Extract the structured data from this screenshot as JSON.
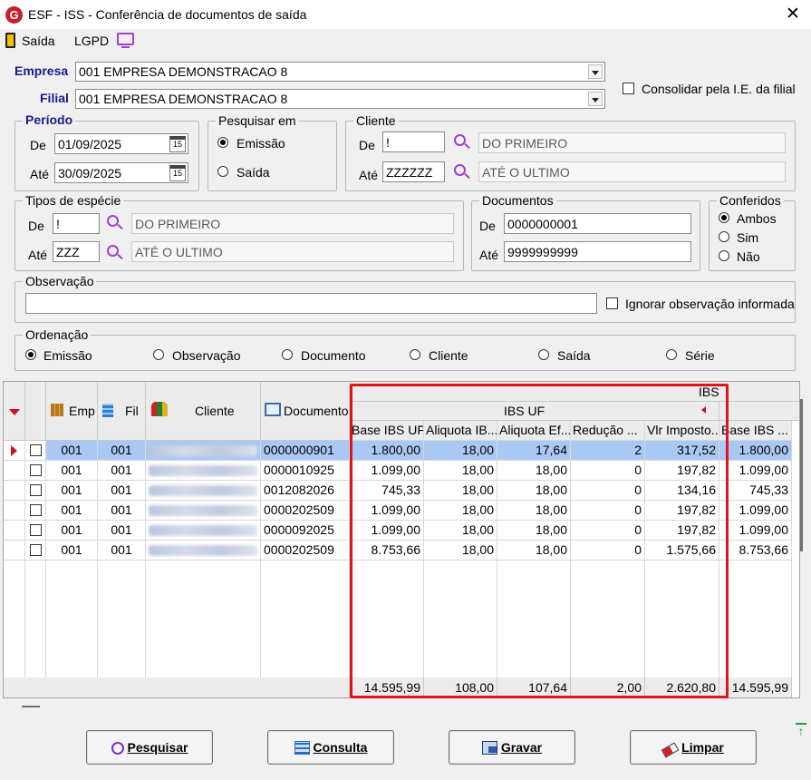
{
  "window": {
    "title": "ESF - ISS - Conferência de documentos de saída",
    "close": "✕"
  },
  "menu": {
    "saida": "Saída",
    "lgpd": "LGPD"
  },
  "empresa": {
    "label": "Empresa",
    "value": "001 EMPRESA DEMONSTRACAO 8"
  },
  "filial": {
    "label": "Filial",
    "value": "001 EMPRESA DEMONSTRACAO 8"
  },
  "consolidar": {
    "label": "Consolidar pela I.E. da filial",
    "checked": false
  },
  "periodo": {
    "title": "Período",
    "de_label": "De",
    "de": "01/09/2025",
    "ate_label": "Até",
    "ate": "30/09/2025",
    "cal_icon": "15"
  },
  "pesquisar_em": {
    "title": "Pesquisar em",
    "options": [
      "Emissão",
      "Saída"
    ],
    "selected": "Emissão"
  },
  "cliente": {
    "title": "Cliente",
    "de_label": "De",
    "de": "!",
    "de_desc": "DO PRIMEIRO",
    "ate_label": "Até",
    "ate": "ZZZZZZ",
    "ate_desc": "ATÉ O ULTIMO"
  },
  "especie": {
    "title": "Tipos de espécie",
    "de_label": "De",
    "de": "!",
    "de_desc": "DO PRIMEIRO",
    "ate_label": "Até",
    "ate": "ZZZ",
    "ate_desc": "ATÉ O ULTIMO"
  },
  "documentos": {
    "title": "Documentos",
    "de_label": "De",
    "de": "0000000001",
    "ate_label": "Até",
    "ate": "9999999999"
  },
  "conferidos": {
    "title": "Conferidos",
    "options": [
      "Ambos",
      "Sim",
      "Não"
    ],
    "selected": "Ambos"
  },
  "observacao": {
    "title": "Observação",
    "value": "",
    "ignorar_label": "Ignorar observação informada"
  },
  "ordenacao": {
    "title": "Ordenação",
    "options": [
      "Emissão",
      "Observação",
      "Documento",
      "Cliente",
      "Saída",
      "Série"
    ],
    "selected": "Emissão"
  },
  "grid": {
    "headers": {
      "emp": "Emp",
      "fil": "Fil",
      "cliente": "Cliente",
      "documento": "Documento",
      "ibs": "IBS",
      "ibs_uf": "IBS UF"
    },
    "subheaders": [
      "Base IBS UF",
      "Aliquota IB...",
      "Aliquota Ef...",
      "Redução ...",
      "Vlr Imposto...",
      "Base IBS ..."
    ],
    "rows": [
      {
        "emp": "001",
        "fil": "001",
        "documento": "0000000901",
        "base": "1.800,00",
        "aliq": "18,00",
        "aliq_ef": "17,64",
        "reducao": "2",
        "vlr": "317,52",
        "base2": "1.800,00"
      },
      {
        "emp": "001",
        "fil": "001",
        "documento": "0000010925",
        "base": "1.099,00",
        "aliq": "18,00",
        "aliq_ef": "18,00",
        "reducao": "0",
        "vlr": "197,82",
        "base2": "1.099,00"
      },
      {
        "emp": "001",
        "fil": "001",
        "documento": "0012082026",
        "base": "745,33",
        "aliq": "18,00",
        "aliq_ef": "18,00",
        "reducao": "0",
        "vlr": "134,16",
        "base2": "745,33"
      },
      {
        "emp": "001",
        "fil": "001",
        "documento": "0000202509",
        "base": "1.099,00",
        "aliq": "18,00",
        "aliq_ef": "18,00",
        "reducao": "0",
        "vlr": "197,82",
        "base2": "1.099,00"
      },
      {
        "emp": "001",
        "fil": "001",
        "documento": "0000092025",
        "base": "1.099,00",
        "aliq": "18,00",
        "aliq_ef": "18,00",
        "reducao": "0",
        "vlr": "197,82",
        "base2": "1.099,00"
      },
      {
        "emp": "001",
        "fil": "001",
        "documento": "0000202509",
        "base": "8.753,66",
        "aliq": "18,00",
        "aliq_ef": "18,00",
        "reducao": "0",
        "vlr": "1.575,66",
        "base2": "8.753,66"
      }
    ],
    "totals": {
      "base": "14.595,99",
      "aliq": "108,00",
      "aliq_ef": "107,64",
      "reducao": "2,00",
      "vlr": "2.620,80",
      "base2": "14.595,99"
    }
  },
  "buttons": {
    "pesquisar": "Pesquisar",
    "consulta": "Consulta",
    "gravar": "Gravar",
    "limpar": "Limpar"
  },
  "colors": {
    "highlight": "#e0141e",
    "selected_row": "#aac8f4",
    "label_blue": "#1a1a8c"
  }
}
